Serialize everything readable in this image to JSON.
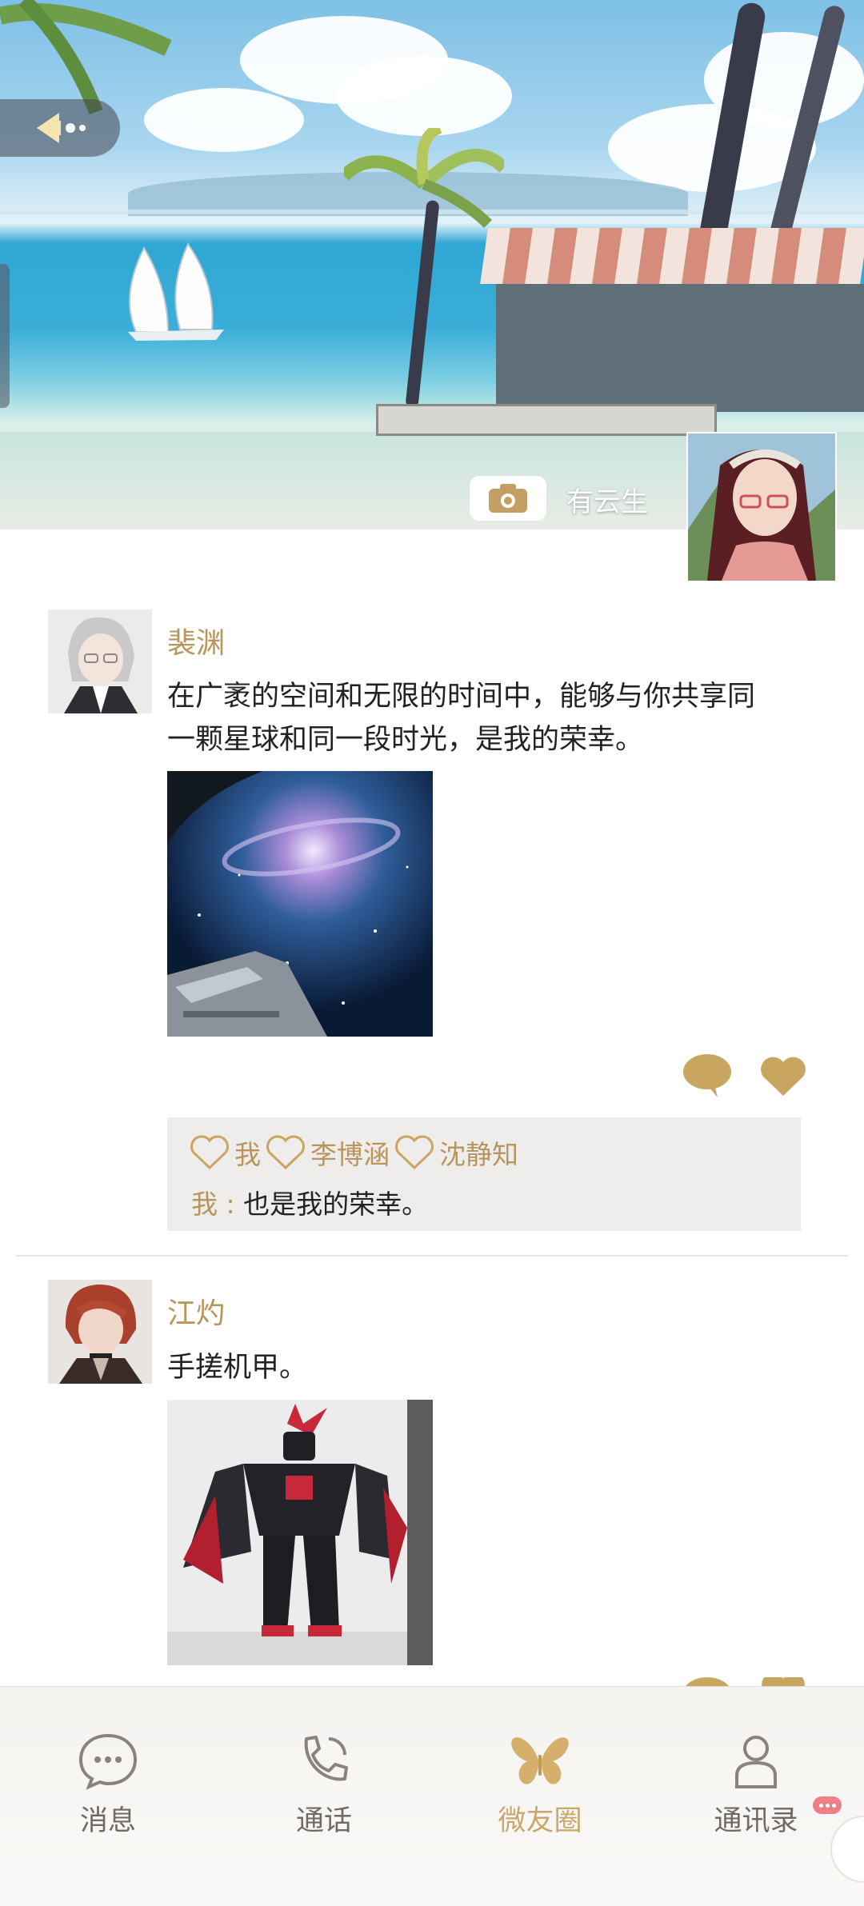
{
  "header": {
    "owner_name": "有云生"
  },
  "posts": [
    {
      "author": "裴渊",
      "text_line1": "在广袤的空间和无限的时间中，能够与你共享同",
      "text_line2": "一颗星球和同一段时光，是我的荣幸。",
      "image": "galaxy-and-spaceship",
      "likes": [
        "我",
        "李博涵",
        "沈静知"
      ],
      "comment": {
        "author": "我",
        "separator": " : ",
        "text": "也是我的荣幸。"
      }
    },
    {
      "author": "江灼",
      "text": "手搓机甲。",
      "image": "mecha-figure"
    }
  ],
  "nav": {
    "items": [
      {
        "label": "消息",
        "icon": "chat-bubble-icon"
      },
      {
        "label": "通话",
        "icon": "phone-icon"
      },
      {
        "label": "微友圈",
        "icon": "butterfly-icon",
        "active": true
      },
      {
        "label": "通讯录",
        "icon": "person-icon"
      }
    ]
  },
  "colors": {
    "accent": "#b8955c",
    "badge": "#ee7f86",
    "interact_bg": "#efedeb"
  }
}
